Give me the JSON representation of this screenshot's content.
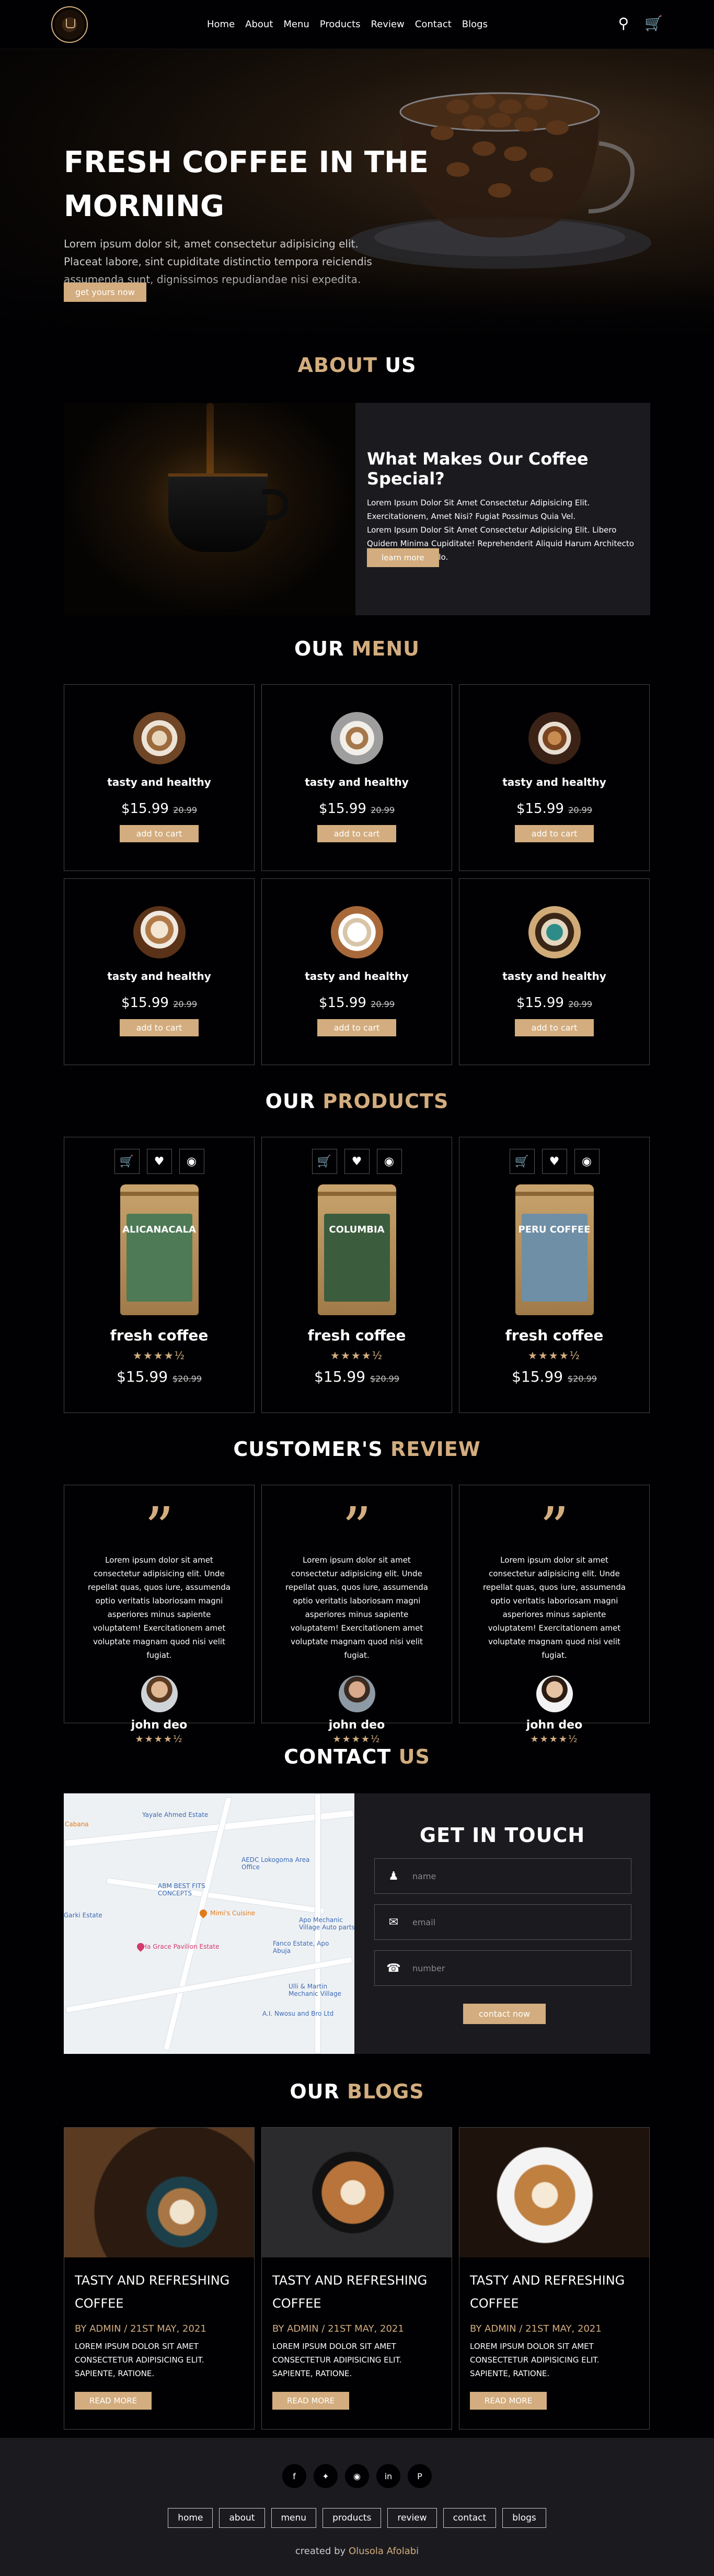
{
  "header": {
    "nav": [
      "Home",
      "About",
      "Menu",
      "Products",
      "Review",
      "Contact",
      "Blogs"
    ],
    "icons": [
      "search-icon",
      "cart-icon"
    ]
  },
  "hero": {
    "title": "FRESH COFFEE IN THE MORNING",
    "text": "Lorem ipsum dolor sit, amet consectetur adipisicing elit. Placeat labore, sint cupiditate distinctio tempora reiciendis assumenda sunt, dignissimos repudiandae nisi expedita.",
    "button": "get yours now"
  },
  "about": {
    "heading_main": "ABOUT",
    "heading_accent": "US",
    "title": "What Makes Our Coffee Special?",
    "p1": "Lorem Ipsum Dolor Sit Amet Consectetur Adipisicing Elit. Exercitationem, Amet Nisi? Fugiat Possimus Quia Vel.",
    "p2": "Lorem Ipsum Dolor Sit Amet Consectetur Adipisicing Elit. Libero Quidem Minima Cupiditate! Reprehenderit Aliquid Harum Architecto Nemo Quae Quo Illo.",
    "button": "learn more"
  },
  "menu": {
    "heading_main": "OUR",
    "heading_accent": "MENU",
    "items": [
      {
        "name": "tasty and healthy",
        "price": "$15.99",
        "old": "20.99",
        "button": "add to cart"
      },
      {
        "name": "tasty and healthy",
        "price": "$15.99",
        "old": "20.99",
        "button": "add to cart"
      },
      {
        "name": "tasty and healthy",
        "price": "$15.99",
        "old": "20.99",
        "button": "add to cart"
      },
      {
        "name": "tasty and healthy",
        "price": "$15.99",
        "old": "20.99",
        "button": "add to cart"
      },
      {
        "name": "tasty and healthy",
        "price": "$15.99",
        "old": "20.99",
        "button": "add to cart"
      },
      {
        "name": "tasty and healthy",
        "price": "$15.99",
        "old": "20.99",
        "button": "add to cart"
      }
    ]
  },
  "products": {
    "heading_main": "OUR",
    "heading_accent": "PRODUCTS",
    "items": [
      {
        "bag_label": "ALICANACALA",
        "bag_color": "#4e7a55",
        "name": "fresh coffee",
        "stars": "★★★★½",
        "rating": 4.5,
        "price": "$15.99",
        "old": "$20.99"
      },
      {
        "bag_label": "COLUMBIA",
        "bag_color": "#3c5c3e",
        "name": "fresh coffee",
        "stars": "★★★★½",
        "rating": 4.5,
        "price": "$15.99",
        "old": "$20.99"
      },
      {
        "bag_label": "PERU COFFEE",
        "bag_color": "#6f8fa6",
        "name": "fresh coffee",
        "stars": "★★★★½",
        "rating": 4.5,
        "price": "$15.99",
        "old": "$20.99"
      }
    ],
    "action_icons": [
      "cart-icon",
      "heart-icon",
      "eye-icon"
    ]
  },
  "review": {
    "heading_main": "CUSTOMER'S",
    "heading_accent": "REVIEW",
    "items": [
      {
        "text": "Lorem ipsum dolor sit amet consectetur adipisicing elit. Unde repellat quas, quos iure, assumenda optio veritatis laboriosam magni asperiores minus sapiente voluptatem! Exercitationem amet voluptate magnam quod nisi velit fugiat.",
        "name": "john deo",
        "stars": "★★★★½",
        "rating": 4.5
      },
      {
        "text": "Lorem ipsum dolor sit amet consectetur adipisicing elit. Unde repellat quas, quos iure, assumenda optio veritatis laboriosam magni asperiores minus sapiente voluptatem! Exercitationem amet voluptate magnam quod nisi velit fugiat.",
        "name": "john deo",
        "stars": "★★★★½",
        "rating": 4.5
      },
      {
        "text": "Lorem ipsum dolor sit amet consectetur adipisicing elit. Unde repellat quas, quos iure, assumenda optio veritatis laboriosam magni asperiores minus sapiente voluptatem! Exercitationem amet voluptate magnam quod nisi velit fugiat.",
        "name": "john deo",
        "stars": "★★★★½",
        "rating": 4.5
      }
    ]
  },
  "contact": {
    "heading_main": "CONTACT",
    "heading_accent": "US",
    "form_title": "GET IN TOUCH",
    "name_placeholder": "name",
    "email_placeholder": "email",
    "number_placeholder": "number",
    "button": "contact now",
    "map_labels": [
      "Yayale Ahmed Estate",
      "AEDC Lokogoma Area Office",
      "ABM BEST FITS CONCEPTS",
      "Mimi's Cuisine",
      "Apo Mechanic Village Auto parts",
      "Garki Estate",
      "Ha Grace Pavilion Estate",
      "Fanco Estate, Apo Abuja",
      "Ulli & Martin Mechanic Village",
      "A.I. Nwosu and Bro Ltd",
      "Cabana"
    ]
  },
  "blogs": {
    "heading_main": "OUR",
    "heading_accent": "BLOGS",
    "items": [
      {
        "title": "TASTY AND REFRESHING COFFEE",
        "date": "BY ADMIN / 21ST MAY, 2021",
        "text": "LOREM IPSUM DOLOR SIT AMET CONSECTETUR ADIPISICING ELIT. SAPIENTE, RATIONE.",
        "button": "READ MORE"
      },
      {
        "title": "TASTY AND REFRESHING COFFEE",
        "date": "BY ADMIN / 21ST MAY, 2021",
        "text": "LOREM IPSUM DOLOR SIT AMET CONSECTETUR ADIPISICING ELIT. SAPIENTE, RATIONE.",
        "button": "READ MORE"
      },
      {
        "title": "TASTY AND REFRESHING COFFEE",
        "date": "BY ADMIN / 21ST MAY, 2021",
        "text": "LOREM IPSUM DOLOR SIT AMET CONSECTETUR ADIPISICING ELIT. SAPIENTE, RATIONE.",
        "button": "READ MORE"
      }
    ]
  },
  "footer": {
    "social_icons": [
      "facebook-icon",
      "twitter-icon",
      "instagram-icon",
      "linkedin-icon",
      "pinterest-icon"
    ],
    "links": [
      "home",
      "about",
      "menu",
      "products",
      "review",
      "contact",
      "blogs"
    ],
    "credit_prefix": "created by",
    "credit_name": "Olusola Afolabi"
  },
  "colors": {
    "accent": "#d3ad7f",
    "background": "#010103",
    "panel": "#1b1b1f"
  }
}
